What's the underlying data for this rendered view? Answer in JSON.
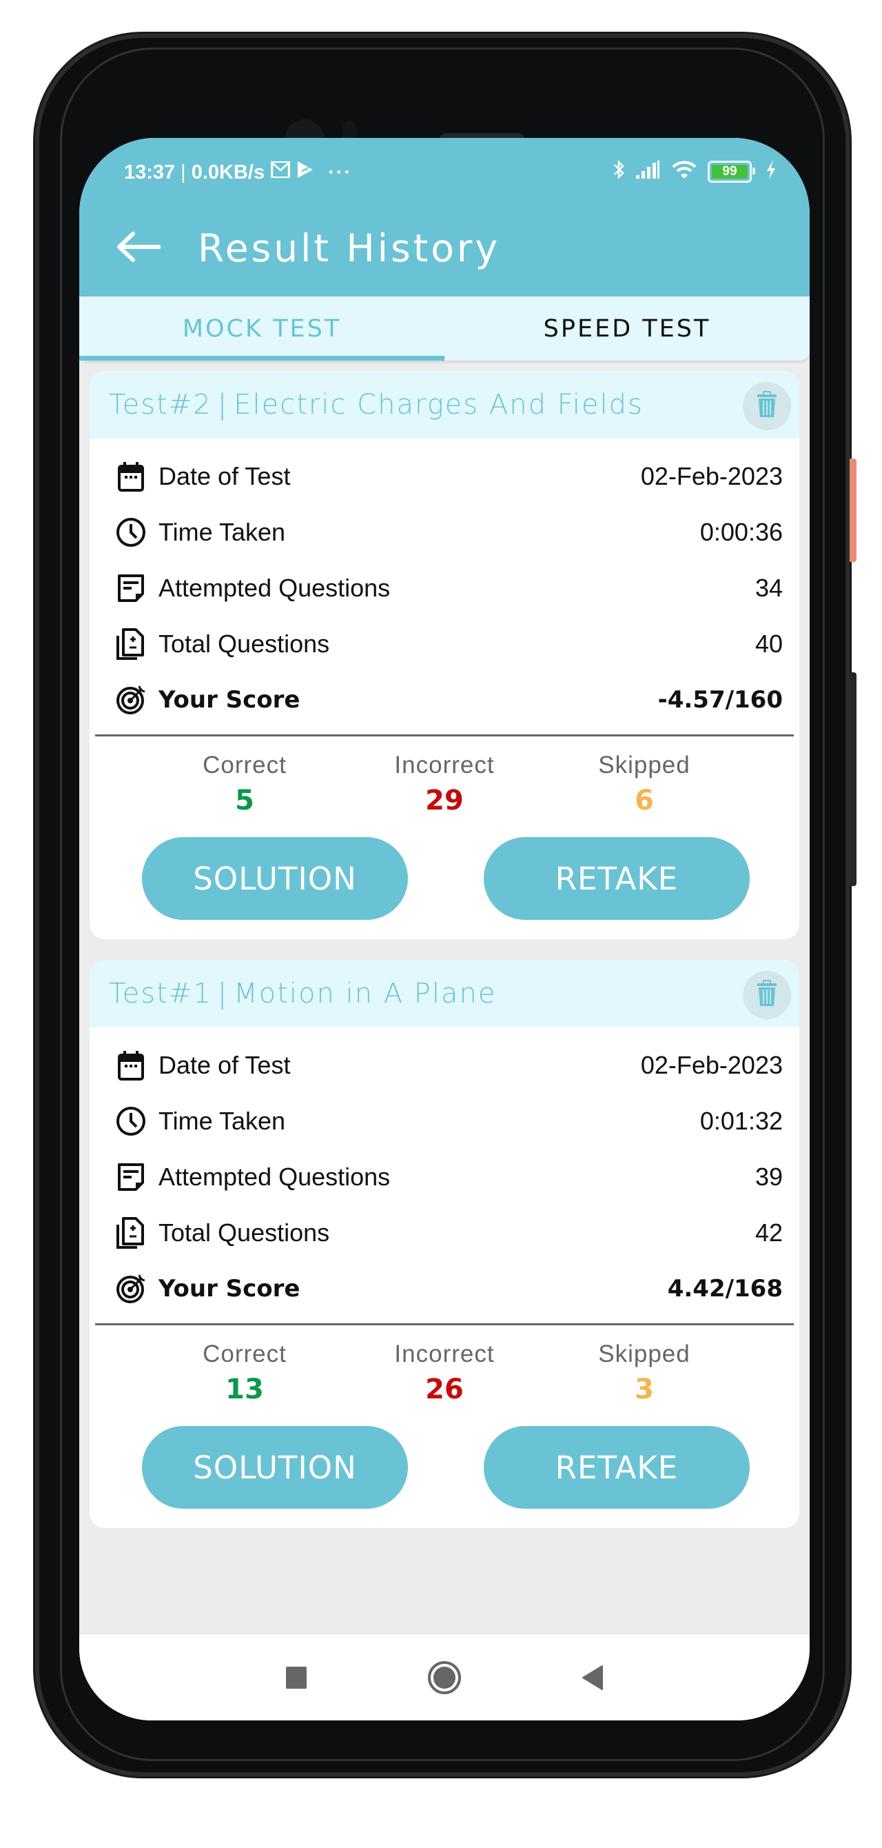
{
  "status_bar": {
    "time": "13:37",
    "separator": "|",
    "network_speed": "0.0KB/s",
    "more": "···",
    "battery_level": "99"
  },
  "app_bar": {
    "title": "Result History"
  },
  "tabs": [
    {
      "label": "MOCK TEST",
      "active": true
    },
    {
      "label": "SPEED TEST",
      "active": false
    }
  ],
  "labels": {
    "date": "Date of Test",
    "time": "Time Taken",
    "attempted": "Attempted Questions",
    "total": "Total Questions",
    "score": "Your Score",
    "correct": "Correct",
    "incorrect": "Incorrect",
    "skipped": "Skipped",
    "solution_button": "SOLUTION",
    "retake_button": "RETAKE"
  },
  "colors": {
    "accent": "#69c3d4",
    "correct": "#0a9a4a",
    "incorrect": "#c40c0c",
    "skipped": "#f4b54f"
  },
  "results": [
    {
      "test_number": "Test#2",
      "separator": "|",
      "subject": "Electric Charges And Fields",
      "date": "02-Feb-2023",
      "time_taken": "0:00:36",
      "attempted": "34",
      "total": "40",
      "score": "-4.57/160",
      "correct": "5",
      "incorrect": "29",
      "skipped": "6"
    },
    {
      "test_number": "Test#1",
      "separator": "|",
      "subject": "Motion in A Plane",
      "date": "02-Feb-2023",
      "time_taken": "0:01:32",
      "attempted": "39",
      "total": "42",
      "score": "4.42/168",
      "correct": "13",
      "incorrect": "26",
      "skipped": "3"
    }
  ]
}
